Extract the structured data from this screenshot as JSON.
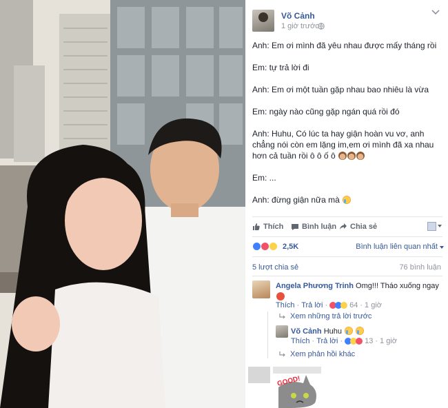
{
  "post": {
    "author_name": "Võ Cảnh",
    "time": "1 giờ trước",
    "icons": {
      "privacy": "globe-icon",
      "options": "chevron-down-icon"
    },
    "lines": [
      "Anh: Em ơi mình đã yêu nhau được mấy tháng rồi",
      "Em: tự trả lời đi",
      "Anh: Em ơi một tuần gặp nhau bao nhiêu là vừa",
      "Em: ngày nào cũng gặp ngán quá rồi đó",
      "Anh: Huhu, Có lúc ta hay giận hoàn vu vơ, anh chẳng nói còn em lặng im,em ơi mình đã xa nhau hơn cả tuần rồi ô ô ố ô",
      "Em: ...",
      "Anh: đừng giận nữa mà"
    ]
  },
  "actions": {
    "like": "Thích",
    "comment": "Bình luận",
    "share": "Chia sẻ"
  },
  "reactions": {
    "count": "2,5K",
    "types": [
      "like",
      "love",
      "haha"
    ],
    "filter_label": "Bình luận liên quan nhất"
  },
  "stats": {
    "shares": "5 lượt chia sẻ",
    "comments": "76 bình luận"
  },
  "comments": [
    {
      "name": "Angela Phương Trinh",
      "text": "Omg!!! Tháo xuống ngay",
      "like": "Thích",
      "reply": "Trả lời",
      "reaction_count": "64",
      "time": "1 giờ",
      "view_previous": "Xem những trả lời trước",
      "reply_comment": {
        "name": "Võ Cảnh",
        "text": "Huhu",
        "like": "Thích",
        "reply": "Trả lời",
        "reaction_count": "13",
        "time": "1 giờ"
      },
      "more_replies": "Xem phản hồi khác"
    }
  ],
  "sticker_text": "GOOD!",
  "colors": {
    "link": "#365899",
    "muted": "#90949c",
    "like_blue": "#4080ff",
    "love_red": "#f25268",
    "haha_yellow": "#fcd24a"
  }
}
